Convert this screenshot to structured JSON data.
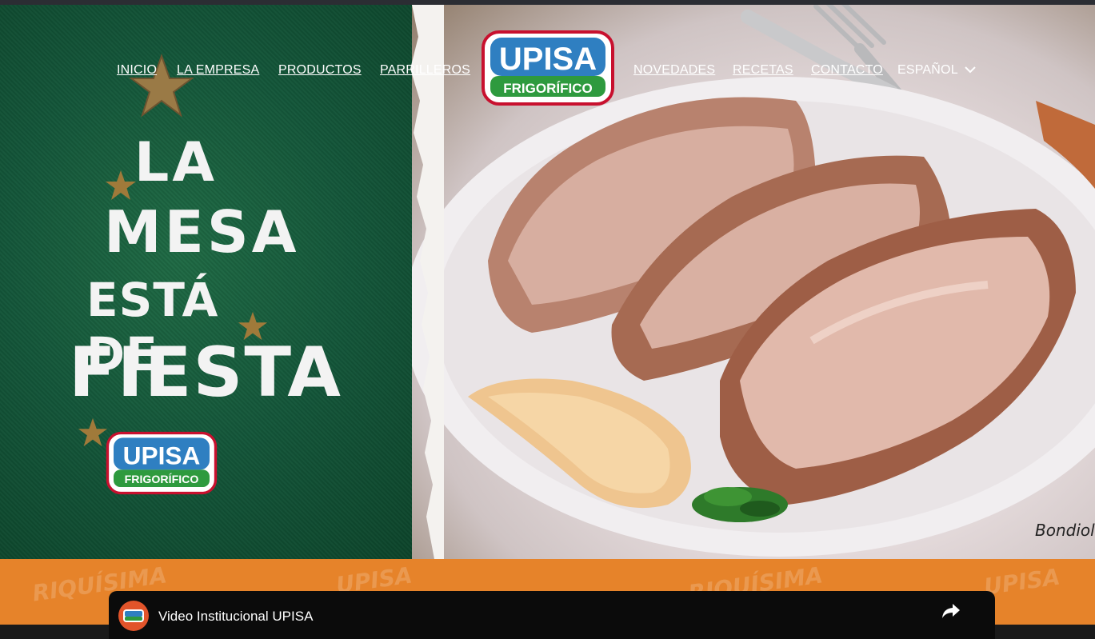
{
  "nav": {
    "left": [
      "INICIO",
      "LA EMPRESA",
      "PRODUCTOS",
      "PARRILLEROS"
    ],
    "right": [
      "NOVEDADES",
      "RECETAS",
      "CONTACTO"
    ],
    "language": "ESPAÑOL",
    "language_icon": "chevron-down-icon"
  },
  "brand": {
    "name": "UPISA",
    "subtitle": "FRIGORÍFICO"
  },
  "hero": {
    "slogan": [
      "LA",
      "MESA",
      "ESTÁ DE",
      "FIESTA"
    ],
    "caption": "Bondiola"
  },
  "strip": {
    "pattern_text": [
      "RIQUÍSIMA",
      "UPISA"
    ]
  },
  "video": {
    "title": "Video Institucional UPISA",
    "share_icon": "share-icon"
  },
  "colors": {
    "green": "#14573a",
    "orange": "#e6832a",
    "brand_blue": "#2f7fc1",
    "brand_green": "#2e9a3e",
    "brand_red": "#c8102e",
    "gold": "#a07a3a"
  }
}
